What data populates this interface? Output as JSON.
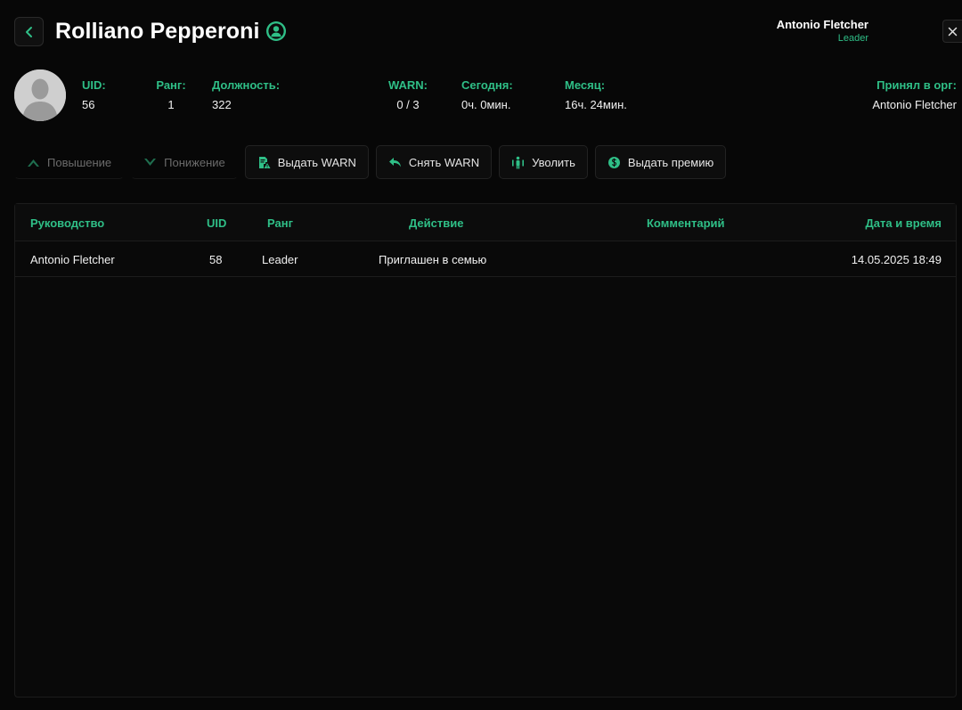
{
  "header": {
    "title": "Rolliano Pepperoni",
    "current_user_name": "Antonio Fletcher",
    "current_user_role": "Leader"
  },
  "profile": {
    "uid_label": "UID:",
    "uid_value": "56",
    "rank_label": "Ранг:",
    "rank_value": "1",
    "position_label": "Должность:",
    "position_value": "322",
    "warn_label": "WARN:",
    "warn_value": "0 / 3",
    "today_label": "Сегодня:",
    "today_value": "0ч. 0мин.",
    "month_label": "Месяц:",
    "month_value": "16ч. 24мин.",
    "accepted_label": "Принял в орг:",
    "accepted_value": "Antonio Fletcher"
  },
  "actions": {
    "promote": "Повышение",
    "demote": "Понижение",
    "give_warn": "Выдать WARN",
    "remove_warn": "Снять WARN",
    "fire": "Уволить",
    "give_bonus": "Выдать премию"
  },
  "table": {
    "columns": [
      "Руководство",
      "UID",
      "Ранг",
      "Действие",
      "Комментарий",
      "Дата и время"
    ],
    "rows": [
      [
        "Antonio Fletcher",
        "58",
        "Leader",
        "Приглашен в семью",
        "",
        "14.05.2025 18:49"
      ]
    ]
  },
  "colors": {
    "accent": "#2fbf87",
    "background": "#070707",
    "disabled_text": "#6b6b6b"
  },
  "icons": [
    "chevron-left-icon",
    "user-circle-icon",
    "close-icon",
    "avatar-silhouette-icon",
    "chevron-up-icon",
    "chevron-down-icon",
    "document-warning-icon",
    "undo-arrow-icon",
    "fire-user-icon",
    "dollar-coin-icon"
  ]
}
